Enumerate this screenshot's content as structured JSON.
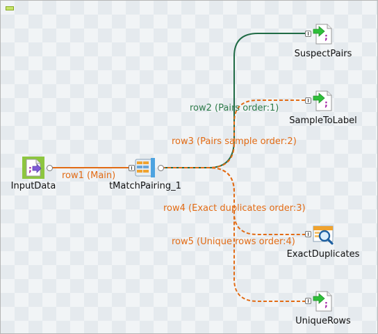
{
  "components": {
    "input": {
      "label": "InputData"
    },
    "match": {
      "label": "tMatchPairing_1"
    },
    "suspect": {
      "label": "SuspectPairs"
    },
    "sample": {
      "label": "SampleToLabel"
    },
    "exact": {
      "label": "ExactDuplicates"
    },
    "unique": {
      "label": "UniqueRows"
    }
  },
  "links": {
    "row1": "row1 (Main)",
    "row2": "row2 (Pairs order:1)",
    "row3": "row3 (Pairs sample order:2)",
    "row4": "row4 (Exact duplicates order:3)",
    "row5": "row5 (Unique rows order:4)"
  },
  "colors": {
    "main_link": "#e26b14",
    "reject_link": "#1f6b45",
    "output_arrow": "#2fbf3a",
    "input_bg": "#8dc63f",
    "canvas_bg": "#f1f4f6"
  },
  "icons": {
    "input": "file-input-icon",
    "match": "match-pairing-icon",
    "output": "file-output-icon",
    "exact": "magnifier-table-icon"
  }
}
